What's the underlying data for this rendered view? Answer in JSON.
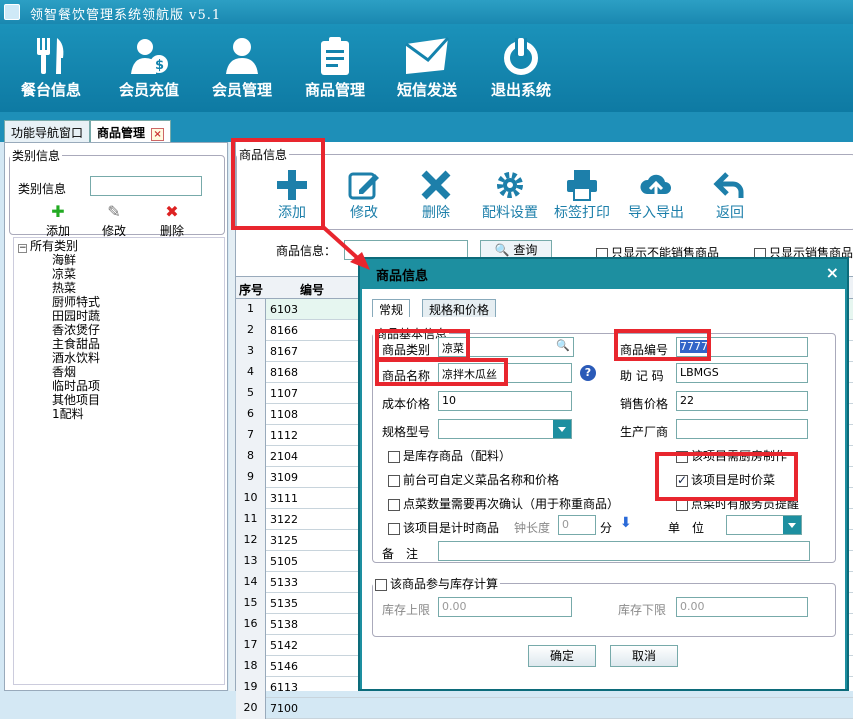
{
  "window": {
    "title": "领智餐饮管理系统领航版 v5.1"
  },
  "toolbar": [
    {
      "label": "餐台信息",
      "icon": "fork-knife-icon"
    },
    {
      "label": "会员充值",
      "icon": "member-money-icon"
    },
    {
      "label": "会员管理",
      "icon": "user-icon"
    },
    {
      "label": "商品管理",
      "icon": "clipboard-icon"
    },
    {
      "label": "短信发送",
      "icon": "envelope-icon"
    },
    {
      "label": "退出系统",
      "icon": "power-icon"
    }
  ],
  "tabs": {
    "nav": "功能导航窗口",
    "goods": "商品管理",
    "close": "×"
  },
  "left": {
    "group_title": "类别信息",
    "category_label": "类别信息",
    "buttons": {
      "add": "添加",
      "edit": "修改",
      "delete": "删除"
    },
    "tree_root": "所有类别",
    "tree_items": [
      "海鲜",
      "凉菜",
      "热菜",
      "厨师特式",
      "田园时蔬",
      "香浓煲仔",
      "主食甜品",
      "酒水饮料",
      "香烟",
      "临时品项",
      "其他项目",
      "1配料"
    ]
  },
  "right": {
    "group_title": "商品信息",
    "buttons": [
      {
        "label": "添加",
        "icon": "plus-icon"
      },
      {
        "label": "修改",
        "icon": "edit-icon"
      },
      {
        "label": "删除",
        "icon": "delete-x-icon"
      },
      {
        "label": "配料设置",
        "icon": "gear-icon"
      },
      {
        "label": "标签打印",
        "icon": "printer-icon"
      },
      {
        "label": "导入导出",
        "icon": "cloud-upload-icon"
      },
      {
        "label": "返回",
        "icon": "back-arrow-icon"
      }
    ],
    "search_label": "商品信息：",
    "search_button": "查询",
    "only_unsold": "只显示不能销售商品",
    "only_sold": "只显示销售商品",
    "grid": {
      "headers": [
        "序号",
        "编号"
      ],
      "rows": [
        {
          "no": "1",
          "code": "6103"
        },
        {
          "no": "2",
          "code": "8166"
        },
        {
          "no": "3",
          "code": "8167"
        },
        {
          "no": "4",
          "code": "8168"
        },
        {
          "no": "5",
          "code": "1107"
        },
        {
          "no": "6",
          "code": "1108"
        },
        {
          "no": "7",
          "code": "1112"
        },
        {
          "no": "8",
          "code": "2104"
        },
        {
          "no": "9",
          "code": "3109"
        },
        {
          "no": "10",
          "code": "3111"
        },
        {
          "no": "11",
          "code": "3122"
        },
        {
          "no": "12",
          "code": "3125"
        },
        {
          "no": "13",
          "code": "5105"
        },
        {
          "no": "14",
          "code": "5133"
        },
        {
          "no": "15",
          "code": "5135"
        },
        {
          "no": "16",
          "code": "5138"
        },
        {
          "no": "17",
          "code": "5142"
        },
        {
          "no": "18",
          "code": "5146"
        },
        {
          "no": "19",
          "code": "6113"
        },
        {
          "no": "20",
          "code": "7100"
        }
      ]
    }
  },
  "modal": {
    "title": "商品信息",
    "close": "×",
    "tabs": [
      "常规",
      "规格和价格"
    ],
    "basic_group": "商品基本信息",
    "fields": {
      "category_label": "商品类别",
      "category_value": "凉菜",
      "code_label": "商品编号",
      "code_value": "7777",
      "name_label": "商品名称",
      "name_value": "凉拌木瓜丝",
      "mnemonic_label": "助 记 码",
      "mnemonic_value": "LBMGS",
      "cost_label": "成本价格",
      "cost_value": "10",
      "sale_label": "销售价格",
      "sale_value": "22",
      "spec_label": "规格型号",
      "spec_value": "",
      "maker_label": "生产厂商",
      "maker_value": "",
      "minutes_label": "钟长度",
      "minutes_value": "0",
      "minutes_unit": "分",
      "unit_label": "单　位",
      "unit_value": "",
      "remark_label": "备　注",
      "remark_value": ""
    },
    "checks": {
      "stock_item": {
        "label": "是库存商品（配料）",
        "checked": false
      },
      "need_kitchen": {
        "label": "该项目需厨房制作",
        "checked": false
      },
      "custom_name_price": {
        "label": "前台可自定义菜品名称和价格",
        "checked": false
      },
      "market_price": {
        "label": "该项目是时价菜",
        "checked": true
      },
      "confirm_qty": {
        "label": "点菜数量需要再次确认（用于称重商品）",
        "checked": false
      },
      "service_prompt": {
        "label": "点菜时有服务员提醒",
        "checked": false
      },
      "timed_item": {
        "label": "该项目是计时商品",
        "checked": false
      }
    },
    "stock_group": {
      "title": "该商品参与库存计算",
      "upper_label": "库存上限",
      "upper_value": "0.00",
      "lower_label": "库存下限",
      "lower_value": "0.00"
    },
    "ok": "确定",
    "cancel": "取消"
  },
  "colors": {
    "highlight": "#e8262e",
    "toolbar": "#1b92ba",
    "dialog_frame": "#1d8fa0"
  }
}
